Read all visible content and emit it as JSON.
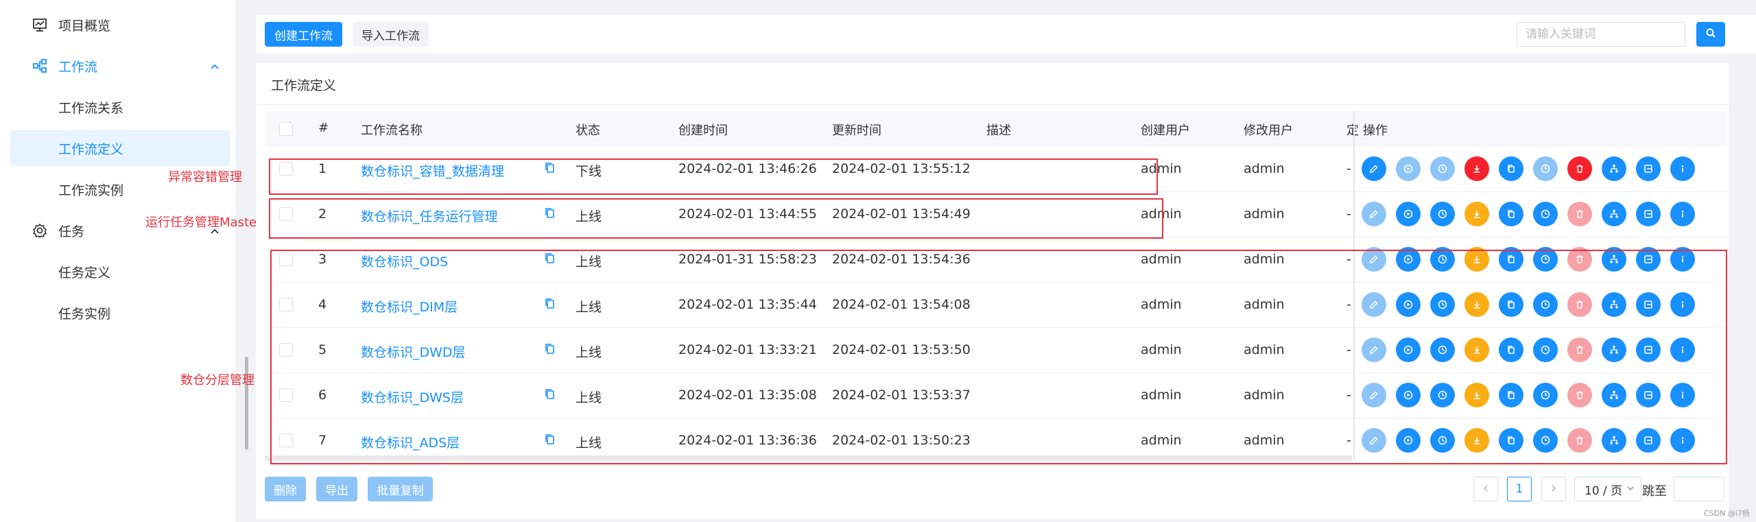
{
  "sidebar": {
    "items": [
      {
        "label": "项目概览"
      },
      {
        "label": "工作流"
      },
      {
        "label": "工作流关系"
      },
      {
        "label": "工作流定义"
      },
      {
        "label": "工作流实例"
      },
      {
        "label": "任务"
      },
      {
        "label": "任务定义"
      },
      {
        "label": "任务实例"
      }
    ]
  },
  "annotations": {
    "fault": "异常容错管理",
    "master": "运行任务管理Master",
    "layers": "数仓分层管理"
  },
  "toolbar": {
    "create_label": "创建工作流",
    "import_label": "导入工作流",
    "search_placeholder": "请输入关键词"
  },
  "panel": {
    "title": "工作流定义"
  },
  "table": {
    "headers": {
      "index": "#",
      "name": "工作流名称",
      "status": "状态",
      "created": "创建时间",
      "updated": "更新时间",
      "desc": "描述",
      "creator": "创建用户",
      "modifier": "修改用户",
      "timing": "定",
      "ops": "操作"
    },
    "rows": [
      {
        "index": "1",
        "name": "数仓标识_容错_数据清理",
        "status": "下线",
        "created": "2024-02-01 13:46:26",
        "updated": "2024-02-01 13:55:12",
        "creator": "admin",
        "modifier": "admin",
        "timing": "-"
      },
      {
        "index": "2",
        "name": "数仓标识_任务运行管理",
        "status": "上线",
        "created": "2024-02-01 13:44:55",
        "updated": "2024-02-01 13:54:49",
        "creator": "admin",
        "modifier": "admin",
        "timing": "-"
      },
      {
        "index": "3",
        "name": "数仓标识_ODS",
        "status": "上线",
        "created": "2024-01-31 15:58:23",
        "updated": "2024-02-01 13:54:36",
        "creator": "admin",
        "modifier": "admin",
        "timing": "-"
      },
      {
        "index": "4",
        "name": "数仓标识_DIM层",
        "status": "上线",
        "created": "2024-02-01 13:35:44",
        "updated": "2024-02-01 13:54:08",
        "creator": "admin",
        "modifier": "admin",
        "timing": "-"
      },
      {
        "index": "5",
        "name": "数仓标识_DWD层",
        "status": "上线",
        "created": "2024-02-01 13:33:21",
        "updated": "2024-02-01 13:53:50",
        "creator": "admin",
        "modifier": "admin",
        "timing": "-"
      },
      {
        "index": "6",
        "name": "数仓标识_DWS层",
        "status": "上线",
        "created": "2024-02-01 13:35:08",
        "updated": "2024-02-01 13:53:37",
        "creator": "admin",
        "modifier": "admin",
        "timing": "-"
      },
      {
        "index": "7",
        "name": "数仓标识_ADS层",
        "status": "上线",
        "created": "2024-02-01 13:36:36",
        "updated": "2024-02-01 13:50:23",
        "creator": "admin",
        "modifier": "admin",
        "timing": "-"
      }
    ]
  },
  "ops_icons": [
    "edit-icon",
    "run-icon",
    "timing-icon",
    "download-icon",
    "copy-icon",
    "clock-icon",
    "delete-icon",
    "tree-icon",
    "export-icon",
    "info-icon"
  ],
  "colors": {
    "primary": "#1890ff",
    "primary_light": "#8cc4f7",
    "warning": "#faad14",
    "danger": "#f5222d",
    "danger_light": "#f7a1a7",
    "annotation": "#e5323e"
  },
  "footer": {
    "delete_label": "删除",
    "export_label": "导出",
    "batch_copy_label": "批量复制",
    "page": "1",
    "page_size": "10 / 页",
    "jump_label": "跳至"
  },
  "watermark": "CSDN @i7杨"
}
